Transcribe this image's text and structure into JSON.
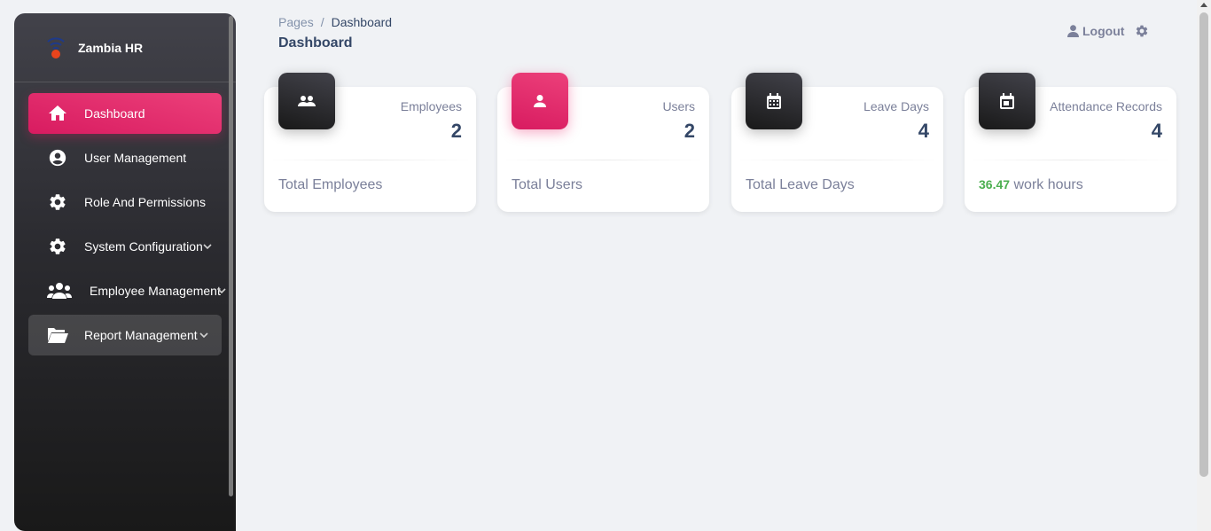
{
  "sidebar": {
    "brand": "Zambia HR",
    "items": [
      {
        "label": "Dashboard",
        "icon": "home-icon"
      },
      {
        "label": "User Management",
        "icon": "account-circle-icon"
      },
      {
        "label": "Role And Permissions",
        "icon": "gear-icon"
      },
      {
        "label": "System Configuration",
        "icon": "gear-icon"
      },
      {
        "label": "Employee Management",
        "icon": "group-icon"
      },
      {
        "label": "Report Management",
        "icon": "folder-open-icon"
      }
    ],
    "active_item": "Dashboard"
  },
  "header": {
    "breadcrumb_root": "Pages",
    "breadcrumb_separator": "/",
    "breadcrumb_current": "Dashboard",
    "title": "Dashboard",
    "logout_label": "Logout"
  },
  "cards": [
    {
      "label": "Employees",
      "value": "2",
      "footer": "Total Employees",
      "icon": "group-icon"
    },
    {
      "label": "Users",
      "value": "2",
      "footer": "Total Users",
      "icon": "person-icon"
    },
    {
      "label": "Leave Days",
      "value": "4",
      "footer": "Total Leave Days",
      "icon": "calendar-icon"
    },
    {
      "label": "Attendance Records",
      "value": "4",
      "footer_highlight": "36.47",
      "footer": " work hours",
      "icon": "event-icon"
    }
  ],
  "colors": {
    "accent_pink": "#e91e63",
    "dark": "#344767",
    "success": "#4caf50",
    "background": "#f0f2f5"
  }
}
